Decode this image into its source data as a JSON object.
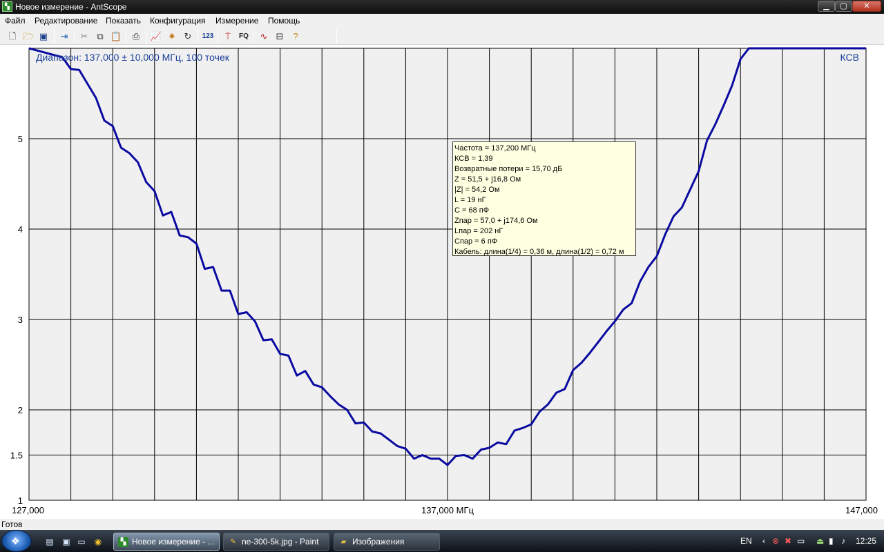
{
  "window": {
    "title": "Новое измерение - AntScope",
    "app_icon": "antscope-icon",
    "controls": {
      "minimize": "minimize-icon",
      "maximize": "maximize-icon",
      "close": "close-icon"
    }
  },
  "menu": {
    "items": [
      "Файл",
      "Редактирование",
      "Показать",
      "Конфигурация",
      "Измерение",
      "Помощь"
    ]
  },
  "toolbar": {
    "buttons": [
      {
        "icon": "new-document-icon"
      },
      {
        "icon": "open-folder-icon"
      },
      {
        "icon": "save-icon"
      },
      {
        "icon": "export-icon"
      },
      {
        "icon": "cut-icon"
      },
      {
        "icon": "copy-icon"
      },
      {
        "icon": "paste-icon"
      },
      {
        "icon": "print-icon"
      },
      {
        "icon": "graph-icon"
      },
      {
        "icon": "scan-icon"
      },
      {
        "icon": "refresh-icon"
      },
      {
        "icon": "numbers-icon",
        "text": "123"
      },
      {
        "icon": "antenna-icon"
      },
      {
        "icon": "frequency-icon",
        "text": "FQ"
      },
      {
        "icon": "waveform-icon"
      },
      {
        "icon": "calibration-icon"
      },
      {
        "icon": "help-icon"
      }
    ]
  },
  "chart_data": {
    "type": "line",
    "title": "Диапазон: 137,000 ± 10,000 МГц, 100 точек",
    "ylabel": "КСВ",
    "xlabel": "",
    "xlim": [
      127.0,
      147.0
    ],
    "ylim": [
      1.0,
      6.0
    ],
    "x_tick_labels": [
      {
        "value": 127.0,
        "label": "127,000"
      },
      {
        "value": 137.0,
        "label": "137,000 МГц"
      },
      {
        "value": 147.0,
        "label": "147,000"
      }
    ],
    "y_tick_labels": [
      {
        "value": 1.0,
        "label": "1"
      },
      {
        "value": 1.5,
        "label": "1.5"
      },
      {
        "value": 2.0,
        "label": "2"
      },
      {
        "value": 3.0,
        "label": "3"
      },
      {
        "value": 4.0,
        "label": "4"
      },
      {
        "value": 5.0,
        "label": "5"
      }
    ],
    "grid": true,
    "grid_x_step": 1.0,
    "cursor_x": 137.0,
    "color": "#0a0aa0",
    "series": [
      {
        "name": "КСВ",
        "x": [
          127.0,
          127.8,
          128.0,
          128.2,
          128.6,
          128.8,
          129.0,
          129.2,
          129.4,
          129.6,
          129.8,
          130.0,
          130.2,
          130.4,
          130.6,
          130.8,
          131.0,
          131.2,
          131.4,
          131.6,
          131.8,
          132.0,
          132.2,
          132.4,
          132.6,
          132.8,
          133.0,
          133.2,
          133.4,
          133.6,
          133.8,
          134.0,
          134.2,
          134.4,
          134.6,
          134.8,
          135.0,
          135.2,
          135.4,
          135.6,
          135.8,
          136.0,
          136.2,
          136.4,
          136.6,
          136.8,
          137.0,
          137.2,
          137.4,
          137.6,
          137.8,
          138.0,
          138.2,
          138.4,
          138.6,
          138.8,
          139.0,
          139.2,
          139.4,
          139.6,
          139.8,
          140.0,
          140.2,
          140.4,
          140.6,
          140.8,
          141.0,
          141.2,
          141.4,
          141.6,
          141.8,
          142.0,
          142.2,
          142.4,
          142.6,
          142.8,
          143.0,
          143.2,
          143.4,
          143.6,
          143.8,
          144.0,
          144.2,
          144.4,
          144.6,
          144.8,
          145.0,
          147.0
        ],
        "values": [
          6.0,
          5.9,
          5.77,
          5.76,
          5.45,
          5.2,
          5.14,
          4.9,
          4.84,
          4.74,
          4.52,
          4.42,
          4.15,
          4.19,
          3.93,
          3.91,
          3.84,
          3.56,
          3.58,
          3.32,
          3.32,
          3.06,
          3.08,
          2.98,
          2.77,
          2.78,
          2.62,
          2.6,
          2.38,
          2.43,
          2.28,
          2.25,
          2.15,
          2.06,
          2.0,
          1.85,
          1.86,
          1.76,
          1.74,
          1.67,
          1.6,
          1.57,
          1.46,
          1.5,
          1.46,
          1.46,
          1.39,
          1.49,
          1.5,
          1.46,
          1.56,
          1.58,
          1.64,
          1.62,
          1.77,
          1.8,
          1.84,
          1.98,
          2.06,
          2.19,
          2.23,
          2.44,
          2.52,
          2.63,
          2.75,
          2.87,
          2.98,
          3.11,
          3.18,
          3.42,
          3.58,
          3.7,
          3.94,
          4.14,
          4.24,
          4.44,
          4.64,
          4.98,
          5.16,
          5.37,
          5.59,
          5.88,
          6.0,
          6.0,
          6.0,
          6.0,
          6.0,
          6.0
        ]
      }
    ]
  },
  "tooltip": {
    "lines": [
      "Частота = 137,200 МГц",
      "КСВ = 1,39",
      "Возвратные потери = 15,70 дБ",
      "Z = 51,5 + j16,8 Ом",
      "|Z| = 54,2 Ом",
      "L = 19 нГ",
      "C = 68 пФ",
      "Zпар = 57,0 + j174,6 Ом",
      "Lпар = 202 нГ",
      "Cпар = 6 пФ",
      "Кабель: длина(1/4) = 0,36 м, длина(1/2) = 0,72 м"
    ]
  },
  "status": {
    "text": "Готов"
  },
  "taskbar": {
    "start_icon": "windows-start-icon",
    "quick_launch": [
      "show-desktop-icon",
      "window-switch-icon",
      "computer-icon",
      "chrome-icon"
    ],
    "tasks": [
      {
        "label": "Новое измерение - ...",
        "icon": "antscope-icon",
        "active": true
      },
      {
        "label": "ne-300-5k.jpg - Paint",
        "icon": "paint-icon",
        "active": false
      },
      {
        "label": "Изображения",
        "icon": "folder-icon",
        "active": false
      }
    ],
    "tray": {
      "language": "EN",
      "icons": [
        "tray-expand-icon",
        "security-icon",
        "network-icon",
        "display-icon",
        "safely-remove-icon",
        "battery-icon",
        "volume-icon"
      ],
      "clock": "12:25"
    }
  },
  "colors": {
    "curve": "#0a0aa0",
    "plot_background": "#f0f0f0",
    "grid": "#000000",
    "tooltip_background": "#ffffe1",
    "label_text": "#1a3f9a"
  }
}
